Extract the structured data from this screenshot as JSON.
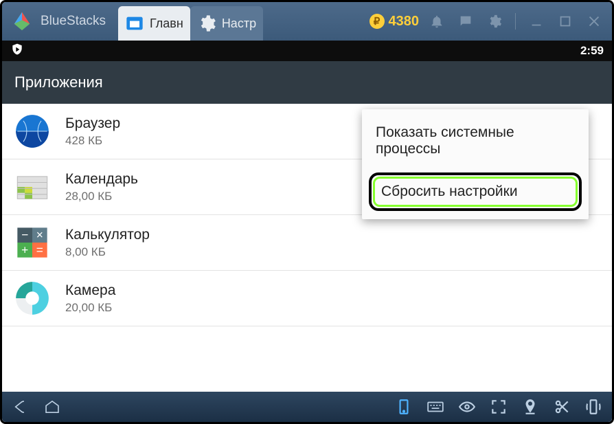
{
  "window": {
    "brand": "BlueStacks"
  },
  "tabs": {
    "home_label": "Главн",
    "settings_label": "Настр"
  },
  "coins": {
    "value": "4380"
  },
  "status": {
    "time": "2:59"
  },
  "toolbar": {
    "title": "Приложения"
  },
  "apps": [
    {
      "name": "Браузер",
      "size": "428 КБ"
    },
    {
      "name": "Календарь",
      "size": "28,00 КБ"
    },
    {
      "name": "Калькулятор",
      "size": "8,00 КБ"
    },
    {
      "name": "Камера",
      "size": "20,00 КБ"
    }
  ],
  "menu": {
    "show_system": "Показать системные процессы",
    "reset": "Сбросить настройки"
  }
}
